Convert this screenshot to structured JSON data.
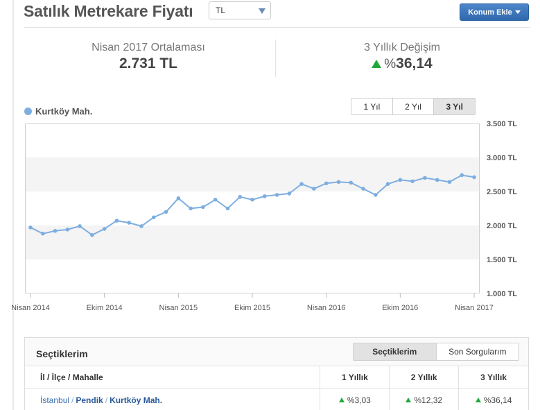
{
  "header": {
    "title": "Satılık Metrekare Fiyatı",
    "currency": "TL",
    "add_location": "Konum Ekle"
  },
  "stats": {
    "average_label": "Nisan 2017 Ortalaması",
    "average_value": "2.731 TL",
    "change_label": "3 Yıllık Değişim",
    "change_prefix": "%",
    "change_value": "36,14"
  },
  "range_buttons": [
    "1 Yıl",
    "2 Yıl",
    "3 Yıl"
  ],
  "active_range": "3 Yıl",
  "colors": {
    "series": "#7eaee0",
    "up": "#22a83a",
    "button": "#3a74b9"
  },
  "chart_data": {
    "type": "line",
    "series": [
      {
        "name": "Kurtköy Mah.",
        "values": [
          1970,
          1880,
          1920,
          1940,
          1990,
          1860,
          1950,
          2070,
          2040,
          1990,
          2120,
          2200,
          2400,
          2250,
          2270,
          2380,
          2250,
          2420,
          2380,
          2430,
          2450,
          2470,
          2610,
          2540,
          2620,
          2640,
          2630,
          2540,
          2450,
          2610,
          2670,
          2650,
          2700,
          2670,
          2640,
          2740,
          2710
        ]
      }
    ],
    "x_ticks": [
      "Nisan 2014",
      "Ekim 2014",
      "Nisan 2015",
      "Ekim 2015",
      "Nisan 2016",
      "Ekim 2016",
      "Nisan 2017"
    ],
    "y_ticks": [
      "1.000 TL",
      "1.500 TL",
      "2.000 TL",
      "2.500 TL",
      "3.000 TL",
      "3.500 TL"
    ],
    "ylim": [
      1000,
      3500
    ],
    "legend": "top-left",
    "grid": "alternating bands"
  },
  "panel": {
    "title": "Seçtiklerim",
    "tabs": [
      "Seçtiklerim",
      "Son Sorgularım"
    ],
    "columns": [
      "İl / İlçe / Mahalle",
      "1 Yıllık",
      "2 Yıllık",
      "3 Yıllık"
    ],
    "rows": [
      {
        "il": "İstanbul",
        "ilce": "Pendik",
        "mahalle": "Kurtköy Mah.",
        "y1": "%3,03",
        "y2": "%12,32",
        "y3": "%36,14"
      }
    ]
  }
}
